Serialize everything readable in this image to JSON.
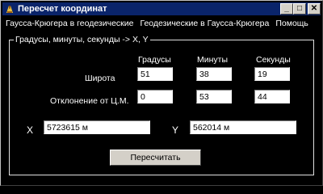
{
  "window": {
    "title": "Пересчет координат",
    "minimize_glyph": "_",
    "maximize_glyph": "□",
    "close_glyph": "✕"
  },
  "menu": {
    "items": [
      {
        "label": "Гаусса-Крюгера в геодезические"
      },
      {
        "label": "Геодезические в Гаусса-Крюгера"
      },
      {
        "label": "Помощь"
      }
    ]
  },
  "group": {
    "label": "Градусы, минуты, секунды -> X, Y"
  },
  "columns": {
    "degrees": "Градусы",
    "minutes": "Минуты",
    "seconds": "Секунды"
  },
  "rows": {
    "latitude": {
      "label": "Широта",
      "degrees": "51",
      "minutes": "38",
      "seconds": "19"
    },
    "deviation": {
      "label": "Отклонение от Ц.М.",
      "degrees": "0",
      "minutes": "53",
      "seconds": "44"
    }
  },
  "result": {
    "x_label": "X",
    "x_value": "5723615 м",
    "y_label": "Y",
    "y_value": "562014 м"
  },
  "actions": {
    "recalc_label": "Пересчитать"
  }
}
